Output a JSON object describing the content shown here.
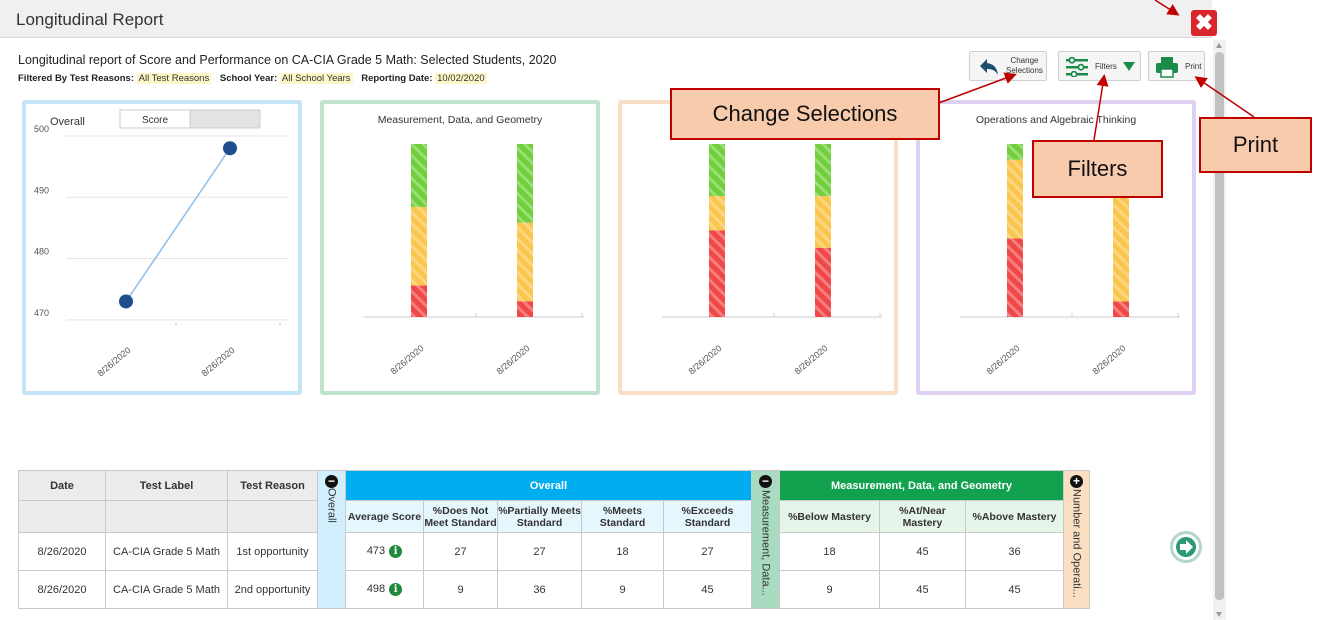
{
  "window": {
    "title": "Longitudinal Report",
    "close_label": "✖"
  },
  "report": {
    "heading": "Longitudinal report of Score and Performance on CA-CIA Grade 5 Math: Selected Students, 2020",
    "filtered_by_label": "Filtered By",
    "filters": [
      {
        "label": "Test Reasons:",
        "value": "All Test Reasons"
      },
      {
        "label": "School Year:",
        "value": "All School Years"
      },
      {
        "label": "Reporting Date:",
        "value": "10/02/2020"
      }
    ]
  },
  "toolbar": {
    "change_line1": "Change",
    "change_line2": "Selections",
    "filters_label": "Filters",
    "print_label": "Print"
  },
  "callouts": {
    "change": "Change Selections",
    "filters": "Filters",
    "print": "Print"
  },
  "colors": {
    "red": "#f04848",
    "yellow": "#fbc64e",
    "green": "#70cf3b",
    "line": "#8fbde8",
    "point": "#1e4e8c",
    "callout_fill": "#f8cbad",
    "callout_border": "#c00000"
  },
  "overall_card": {
    "title": "Overall",
    "toggle_label": "Score"
  },
  "chart_data": [
    {
      "type": "line",
      "title": "Overall",
      "x": [
        "8/26/2020",
        "8/26/2020"
      ],
      "series": [
        {
          "values": [
            473,
            498
          ]
        }
      ],
      "yticks": [
        470,
        480,
        490,
        500
      ],
      "ylim": [
        469,
        500
      ],
      "grid": true
    },
    {
      "type": "bar",
      "stacked": true,
      "title": "Measurement, Data, and Geometry",
      "categories": [
        "8/26/2020",
        "8/26/2020"
      ],
      "series": [
        {
          "name": "Below Mastery",
          "values": [
            18,
            9
          ]
        },
        {
          "name": "At/Near Mastery",
          "values": [
            45,
            45
          ]
        },
        {
          "name": "Above Mastery",
          "values": [
            36,
            45
          ]
        }
      ]
    },
    {
      "type": "bar",
      "stacked": true,
      "title": "",
      "categories": [
        "8/26/2020",
        "8/26/2020"
      ],
      "series": [
        {
          "name": "",
          "values": [
            45,
            36
          ]
        },
        {
          "name": "",
          "values": [
            18,
            27
          ]
        },
        {
          "name": "",
          "values": [
            27,
            27
          ]
        }
      ]
    },
    {
      "type": "bar",
      "stacked": true,
      "title": "Operations and Algebraic Thinking",
      "categories": [
        "8/26/2020",
        "8/26/2020"
      ],
      "series": [
        {
          "name": "",
          "values": [
            45,
            9
          ]
        },
        {
          "name": "",
          "values": [
            45,
            82
          ]
        },
        {
          "name": "",
          "values": [
            9,
            9
          ]
        }
      ]
    }
  ],
  "table": {
    "headers": {
      "date": "Date",
      "test_label": "Test Label",
      "test_reason": "Test Reason",
      "overall_collapse": "Overall",
      "overall_group": "Overall",
      "mdg_collapse": "Measurement, Data...",
      "mdg_group": "Measurement, Data, and Geometry",
      "next_collapse": "Number and Operati..."
    },
    "overall_cols": [
      "Average Score",
      "%Does Not Meet Standard",
      "%Partially Meets Standard",
      "%Meets Standard",
      "%Exceeds Standard"
    ],
    "mdg_cols": [
      "%Below Mastery",
      "%At/Near Mastery",
      "%Above Mastery"
    ],
    "rows": [
      {
        "date": "8/26/2020",
        "test_label": "CA-CIA Grade 5 Math",
        "test_reason": "1st opportunity",
        "avg": "473",
        "dnm": "27",
        "pm": "27",
        "m": "18",
        "e": "27",
        "bm": "18",
        "an": "45",
        "am": "36"
      },
      {
        "date": "8/26/2020",
        "test_label": "CA-CIA Grade 5 Math",
        "test_reason": "2nd opportunity",
        "avg": "498",
        "dnm": "9",
        "pm": "36",
        "m": "9",
        "e": "45",
        "bm": "9",
        "an": "45",
        "am": "45"
      }
    ]
  }
}
